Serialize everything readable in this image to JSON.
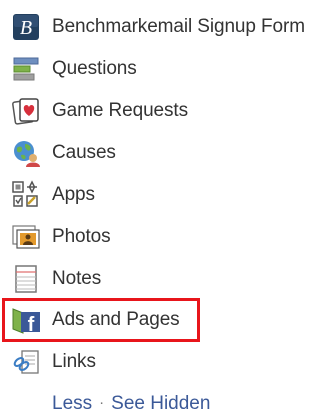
{
  "nav": {
    "items": [
      {
        "label": "Benchmarkemail Signup Form",
        "icon": "benchmark-icon"
      },
      {
        "label": "Questions",
        "icon": "questions-icon"
      },
      {
        "label": "Game Requests",
        "icon": "game-requests-icon"
      },
      {
        "label": "Causes",
        "icon": "causes-icon"
      },
      {
        "label": "Apps",
        "icon": "apps-icon"
      },
      {
        "label": "Photos",
        "icon": "photos-icon"
      },
      {
        "label": "Notes",
        "icon": "notes-icon"
      },
      {
        "label": "Ads and Pages",
        "icon": "ads-pages-icon",
        "highlighted": true
      },
      {
        "label": "Links",
        "icon": "links-icon"
      }
    ],
    "footer": {
      "less": "Less",
      "separator": "·",
      "see_hidden": "See Hidden"
    }
  },
  "colors": {
    "text": "#333333",
    "link": "#3b5998",
    "highlight_border": "#e8151b"
  }
}
